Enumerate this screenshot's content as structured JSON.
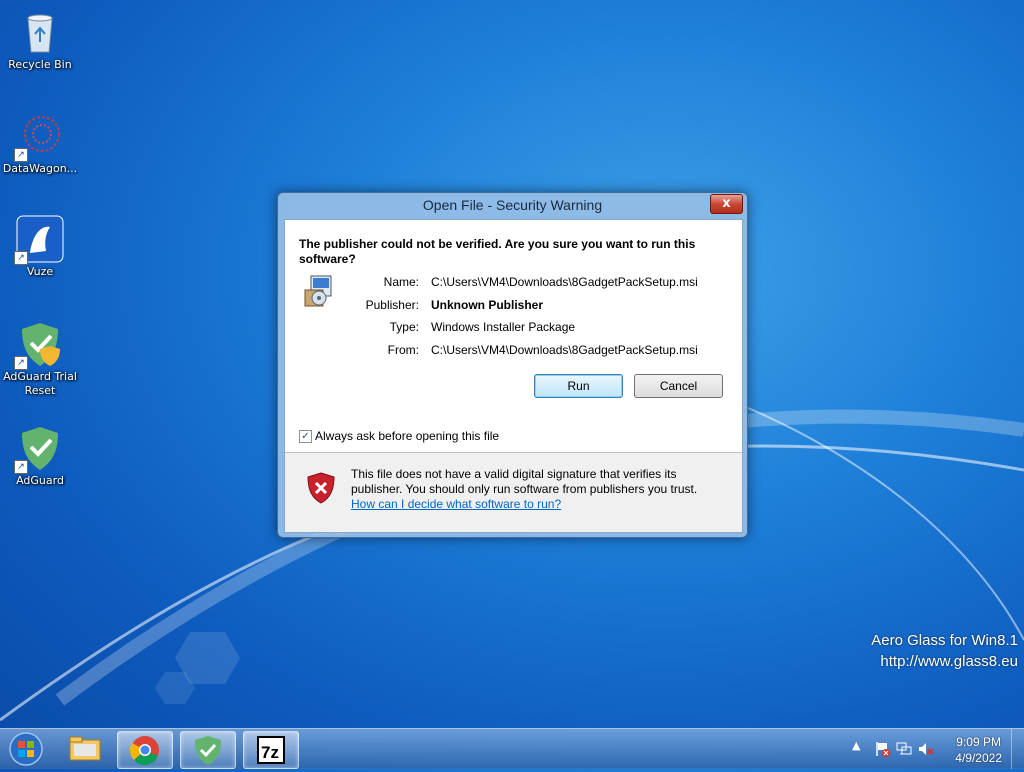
{
  "desktop": {
    "icons": [
      {
        "label": "Recycle Bin"
      },
      {
        "label": "DataWagon..."
      },
      {
        "label": "Vuze"
      },
      {
        "label": "AdGuard Trial Reset"
      },
      {
        "label": "AdGuard"
      }
    ],
    "watermark": {
      "line1": "Aero Glass for Win8.1",
      "line2": "http://www.glass8.eu"
    }
  },
  "dialog": {
    "title": "Open File - Security Warning",
    "close_label": "x",
    "question": "The publisher could not be verified.  Are you sure you want to run this software?",
    "fields": {
      "name_label": "Name:",
      "name_value": "C:\\Users\\VM4\\Downloads\\8GadgetPackSetup.msi",
      "publisher_label": "Publisher:",
      "publisher_value": "Unknown Publisher",
      "type_label": "Type:",
      "type_value": "Windows Installer Package",
      "from_label": "From:",
      "from_value": "C:\\Users\\VM4\\Downloads\\8GadgetPackSetup.msi"
    },
    "run_label": "Run",
    "cancel_label": "Cancel",
    "checkbox_label": "Always ask before opening this file",
    "checkbox_checked": true,
    "checkbox_mark": "✓",
    "warning_text": "This file does not have a valid digital signature that verifies its publisher.  You should only run software from publishers you trust.",
    "warning_link": "How can I decide what software to run?"
  },
  "taskbar": {
    "clock_time": "9:09 PM",
    "clock_date": "4/9/2022",
    "tray_arrow": "▲"
  }
}
